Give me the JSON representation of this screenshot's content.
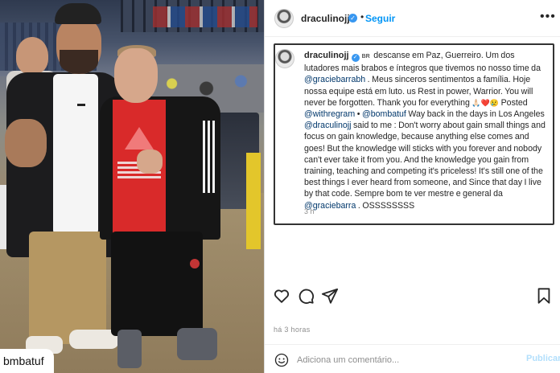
{
  "photo": {
    "caption_fragment": "bmbatuf"
  },
  "header": {
    "username": "draculinojj",
    "separator": "•",
    "follow_label": "Seguir",
    "more_icon": "more-horizontal-icon"
  },
  "comment": {
    "username": "draculinojj",
    "flag": "BR",
    "segments": [
      " descanse em Paz, Guerreiro. Um dos lutadores mais brabos e íntegros que tivemos no nosso time da ",
      "@graciebarrabh",
      " . Meus sinceros sentimentos a família. Hoje nossa equipe está em luto. us Rest in power, Warrior. You will never be forgotten. Thank you for everything ",
      "🙏🏻",
      "❤️",
      "😢",
      " Posted ",
      "@withregram",
      " • ",
      "@bombatuf",
      " Way back in the days in Los Angeles ",
      "@draculinojj",
      " said to me : Don't worry about gain small things and focus on gain knowledge, because anything else comes and goes! But the knowledge will sticks with you forever and nobody can't ever take it from you. And the knowledge you gain from training, teaching and competing it's priceless! It's still one of the best things I ever heard from someone, and Since that day I live by that code. Sempre bom te ver mestre e general da ",
      "@graciebarra",
      " . OSSSSSSSS"
    ],
    "timestamp": "3 h"
  },
  "actions": {
    "like_icon": "heart-icon",
    "comment_icon": "comment-icon",
    "share_icon": "send-icon",
    "save_icon": "bookmark-icon"
  },
  "post_time": "há 3 horas",
  "add_comment": {
    "emoji_icon": "smile-icon",
    "placeholder": "Adiciona um comentário...",
    "post_label": "Publicar"
  },
  "colors": {
    "link": "#0095f6",
    "mention": "#00376b",
    "muted": "#8e8e8e",
    "verified": "#3897f0"
  }
}
